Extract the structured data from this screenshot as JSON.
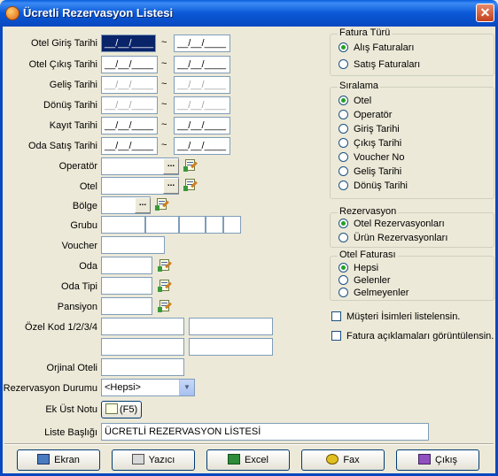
{
  "window": {
    "title": "Ücretli Rezervasyon Listesi",
    "close_label": "✕"
  },
  "date_placeholder": "__/__/____",
  "tilde": "~",
  "labels": {
    "otel_giris": "Otel Giriş Tarihi",
    "otel_cikis": "Otel Çıkış Tarihi",
    "gelis": "Geliş Tarihi",
    "donus": "Dönüş Tarihi",
    "kayit": "Kayıt Tarihi",
    "oda_satis": "Oda Satış Tarihi",
    "operator": "Operatör",
    "otel": "Otel",
    "bolge": "Bölge",
    "grubu": "Grubu",
    "voucher": "Voucher",
    "oda": "Oda",
    "oda_tipi": "Oda Tipi",
    "pansiyon": "Pansiyon",
    "ozel_kod": "Özel Kod 1/2/3/4",
    "orjinal_oteli": "Orjinal Oteli",
    "rez_durumu": "Rezervasyon Durumu",
    "ek_ust_notu": "Ek Üst Notu",
    "liste_basligi": "Liste Başlığı"
  },
  "dots": "...",
  "rez_durumu_value": "<Hepsi>",
  "ek_ust_notu_button": "(F5)",
  "liste_basligi_value": "ÜCRETLİ REZERVASYON LİSTESİ",
  "fatura_turu": {
    "title": "Fatura Türü",
    "options": [
      "Alış Faturaları",
      "Satış Faturaları"
    ],
    "selected": 0
  },
  "siralama": {
    "title": "Sıralama",
    "options": [
      "Otel",
      "Operatör",
      "Giriş Tarihi",
      "Çıkış Tarihi",
      "Voucher No",
      "Geliş Tarihi",
      "Dönüş Tarihi"
    ],
    "selected": 0
  },
  "rezervasyon": {
    "title": "Rezervasyon",
    "options": [
      "Otel Rezervasyonları",
      "Ürün Rezervasyonları"
    ],
    "selected": 0
  },
  "otel_faturasi": {
    "title": "Otel Faturası",
    "options": [
      "Hepsi",
      "Gelenler",
      "Gelmeyenler"
    ],
    "selected": 0
  },
  "checks": {
    "musteri": "Müşteri İsimleri listelensin.",
    "fatura_acik": "Fatura açıklamaları görüntülensin."
  },
  "buttons": {
    "ekran": "Ekran",
    "yazici": "Yazıcı",
    "excel": "Excel",
    "fax": "Fax",
    "cikis": "Çıkış"
  },
  "colors": {
    "titlebar": "#0A58D6",
    "dialog_bg": "#ECE9D8",
    "radio_dot": "#21A121"
  }
}
